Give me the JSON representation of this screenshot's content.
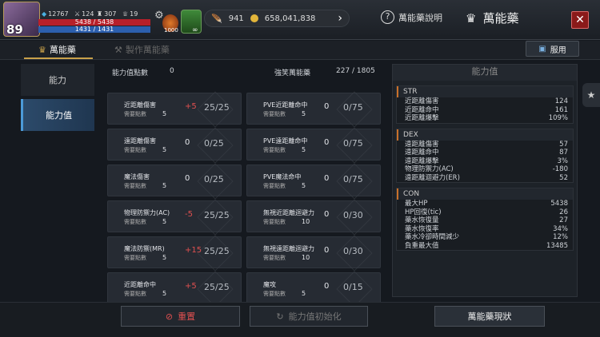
{
  "topbar": {
    "level": "89",
    "stat1": "12767",
    "stat2": "124",
    "stat3": "307",
    "stat4": "19",
    "hp": "5438 / 5438",
    "mp": "1431 / 1431",
    "potion_count": "1000",
    "leaf_count": "∞",
    "wing_count": "941",
    "gold": "658,041,838",
    "help_label": "萬能藥說明",
    "title": "萬能藥",
    "close": "✕"
  },
  "tabs": {
    "tab1": "萬能藥",
    "tab2": "製作萬能藥",
    "use_button": "服用"
  },
  "side": {
    "item1": "能力",
    "item2": "能力值"
  },
  "main": {
    "points_label": "能力值點數",
    "points_value": "0",
    "consumed_label": "強笑萬能藥",
    "consumed_value": "227 / 1805",
    "need_label": "需要點數",
    "cards_left": [
      {
        "name": "近距離傷害",
        "delta": "+5",
        "red": true,
        "pts": "5",
        "prog": "25/25"
      },
      {
        "name": "遠距離傷害",
        "delta": "0",
        "red": false,
        "pts": "5",
        "prog": "0/25"
      },
      {
        "name": "魔法傷害",
        "delta": "0",
        "red": false,
        "pts": "5",
        "prog": "0/25"
      },
      {
        "name": "物理防禦力(AC)",
        "delta": "-5",
        "red": true,
        "pts": "5",
        "prog": "25/25"
      },
      {
        "name": "魔法防禦(MR)",
        "delta": "+15",
        "red": true,
        "pts": "5",
        "prog": "25/25"
      },
      {
        "name": "近距離命中",
        "delta": "+5",
        "red": true,
        "pts": "5",
        "prog": "25/25"
      }
    ],
    "cards_right": [
      {
        "name": "PVE近距離命中",
        "delta": "0",
        "red": false,
        "pts": "5",
        "prog": "0/75"
      },
      {
        "name": "PVE遠距離命中",
        "delta": "0",
        "red": false,
        "pts": "5",
        "prog": "0/75"
      },
      {
        "name": "PVE魔法命中",
        "delta": "0",
        "red": false,
        "pts": "5",
        "prog": "0/75"
      },
      {
        "name": "無視近距離迴避力",
        "delta": "0",
        "red": false,
        "pts": "10",
        "prog": "0/30"
      },
      {
        "name": "無視遠距離迴避力",
        "delta": "0",
        "red": false,
        "pts": "10",
        "prog": "0/30"
      },
      {
        "name": "魔攻",
        "delta": "0",
        "red": false,
        "pts": "5",
        "prog": "0/15"
      }
    ]
  },
  "right": {
    "title": "能力值",
    "sections": [
      {
        "head": "STR",
        "rows": [
          [
            "近距離傷害",
            "124"
          ],
          [
            "近距離命中",
            "161"
          ],
          [
            "近距離爆擊",
            "109%"
          ]
        ]
      },
      {
        "head": "DEX",
        "rows": [
          [
            "遠距離傷害",
            "57"
          ],
          [
            "遠距離命中",
            "87"
          ],
          [
            "遠距離爆擊",
            "3%"
          ],
          [
            "物理防禦力(AC)",
            "-180"
          ],
          [
            "遠距離迴避力(ER)",
            "52"
          ]
        ]
      },
      {
        "head": "CON",
        "rows": [
          [
            "最大HP",
            "5438"
          ],
          [
            "HP回復(tic)",
            "26"
          ],
          [
            "藥水恢復量",
            "27"
          ],
          [
            "藥水恢復率",
            "34%"
          ],
          [
            "藥水冷卻時間減少",
            "12%"
          ],
          [
            "負重最大值",
            "13485"
          ]
        ]
      }
    ]
  },
  "bottom": {
    "reset": "重置",
    "init": "能力值初始化",
    "status": "萬能藥現狀"
  }
}
